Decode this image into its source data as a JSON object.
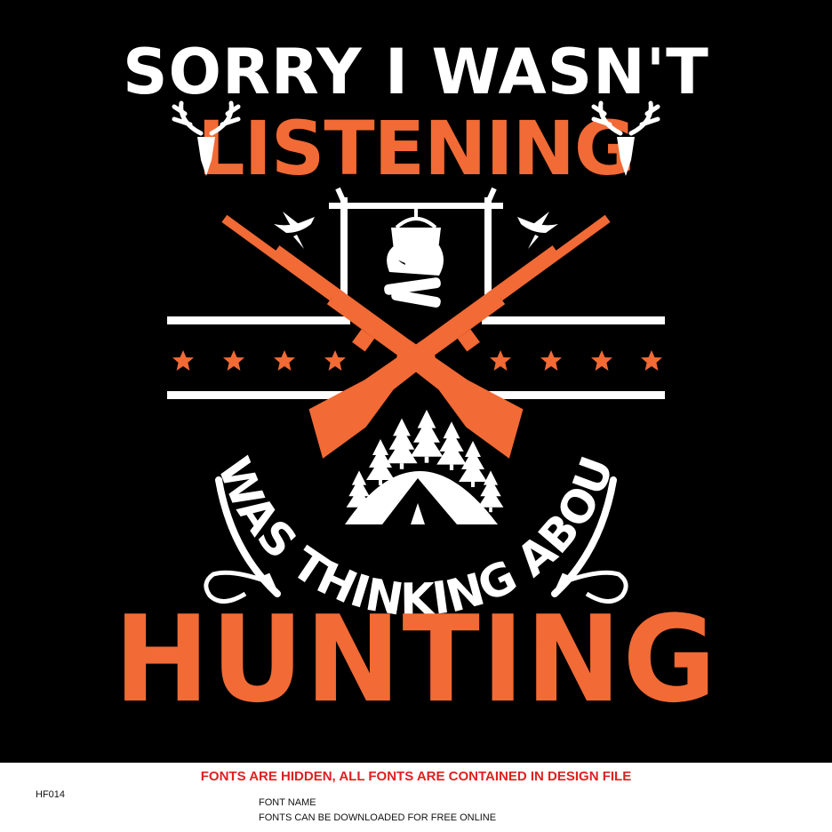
{
  "design": {
    "line1": "SORRY I WASN'T",
    "line2": "LISTENING",
    "arc_text": "I WAS THINKING ABOUT",
    "line4": "HUNTING",
    "colors": {
      "background": "#000000",
      "accent": "#f26a35",
      "text": "#ffffff"
    },
    "icons": [
      "deer-skull-icon",
      "duck-icon",
      "cooking-pot-icon",
      "campfire-icon",
      "crossed-rifles-icon",
      "star-icon",
      "tent-icon",
      "pine-tree-icon",
      "hunting-horn-icon"
    ]
  },
  "footer": {
    "notice": "FONTS ARE HIDDEN, ALL FONTS ARE CONTAINED IN DESIGN FILE",
    "code": "HF014",
    "font_name": "FONT NAME",
    "font_note": "FONTS CAN BE DOWNLOADED FOR FREE ONLINE"
  }
}
